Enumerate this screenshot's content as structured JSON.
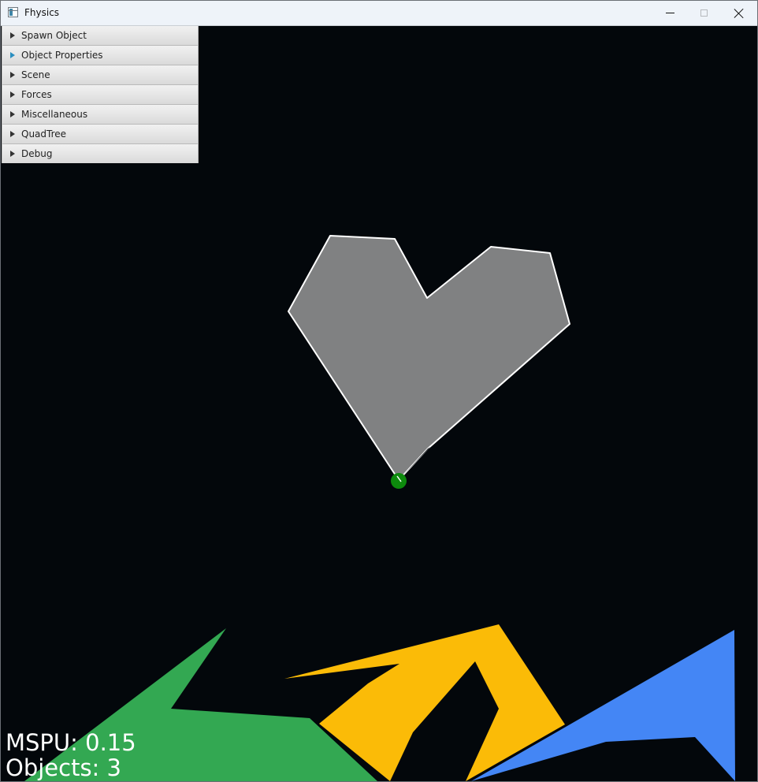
{
  "window": {
    "title": "Fhysics",
    "icon": "app-window-icon"
  },
  "menu": {
    "items": [
      {
        "label": "Spawn Object",
        "icon": "expand-arrow-icon",
        "active": false
      },
      {
        "label": "Object Properties",
        "icon": "expand-arrow-icon",
        "active": true
      },
      {
        "label": "Scene",
        "icon": "expand-arrow-icon",
        "active": false
      },
      {
        "label": "Forces",
        "icon": "expand-arrow-icon",
        "active": false
      },
      {
        "label": "Miscellaneous",
        "icon": "expand-arrow-icon",
        "active": false
      },
      {
        "label": "QuadTree",
        "icon": "expand-arrow-icon",
        "active": false
      },
      {
        "label": "Debug",
        "icon": "expand-arrow-icon",
        "active": false
      }
    ]
  },
  "hud": {
    "mspu": "MSPU: 0.15",
    "objects": "Objects: 3"
  },
  "colors": {
    "background": "#03070b",
    "selected_polygon": "#808182",
    "selection_outline": "#ffffff",
    "pivot_point": "#0d8a0d",
    "green_polygon": "#33a852",
    "yellow_polygon": "#fbbb07",
    "blue_polygon": "#4486f5"
  }
}
